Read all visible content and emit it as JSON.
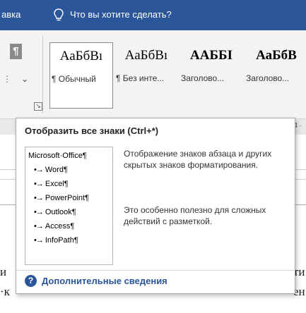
{
  "titlebar": {
    "tab_partial": "авка",
    "tellme_placeholder": "Что вы хотите сделать?"
  },
  "ribbon": {
    "pilcrow": "¶",
    "launcher_glyph": "↘",
    "styles": [
      {
        "preview": "АаБбВı",
        "name": "¶ Обычный",
        "bold": false,
        "selected": true
      },
      {
        "preview": "АаБбВı",
        "name": "¶ Без инте...",
        "bold": false,
        "selected": false
      },
      {
        "preview": "ААББІ",
        "name": "Заголово...",
        "bold": true,
        "selected": false
      },
      {
        "preview": "АаБбВ",
        "name": "Заголово...",
        "bold": true,
        "selected": false
      }
    ]
  },
  "ruler": {
    "partial_number": "4 ·"
  },
  "document": {
    "fragment_1": "и",
    "fragment_2": "·к",
    "fragment_3": "ти",
    "fragment_4": "ен"
  },
  "tooltip": {
    "title": "Отобразить все знаки (Ctrl+*)",
    "preview_title": "Microsoft·Office¶",
    "preview_items": [
      "Word¶",
      "Excel¶",
      "PowerPoint¶",
      "Outlook¶",
      "Access¶",
      "InfoPath¶"
    ],
    "preview_marks": "•→",
    "description_1": "Отображение знаков абзаца и других скрытых знаков форматирования.",
    "description_2": "Это особенно полезно для сложных действий с разметкой.",
    "help_link": "Дополнительные сведения"
  }
}
